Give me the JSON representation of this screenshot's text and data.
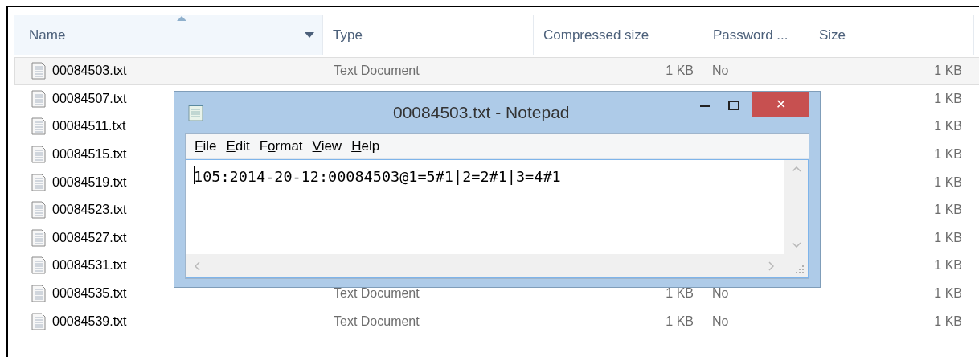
{
  "explorer": {
    "columns": [
      {
        "label": "Name",
        "sorted": true
      },
      {
        "label": "Type",
        "sorted": false
      },
      {
        "label": "Compressed size",
        "sorted": false
      },
      {
        "label": "Password ...",
        "sorted": false
      },
      {
        "label": "Size",
        "sorted": false
      }
    ],
    "rows": [
      {
        "name": "00084503.txt",
        "type": "Text Document",
        "compressed": "1 KB",
        "password": "No",
        "size": "1 KB",
        "selected": true
      },
      {
        "name": "00084507.txt",
        "size": "1 KB",
        "selected": false
      },
      {
        "name": "00084511.txt",
        "size": "1 KB",
        "selected": false
      },
      {
        "name": "00084515.txt",
        "size": "1 KB",
        "selected": false
      },
      {
        "name": "00084519.txt",
        "size": "1 KB",
        "selected": false
      },
      {
        "name": "00084523.txt",
        "size": "1 KB",
        "selected": false
      },
      {
        "name": "00084527.txt",
        "size": "1 KB",
        "selected": false
      },
      {
        "name": "00084531.txt",
        "size": "1 KB",
        "selected": false
      },
      {
        "name": "00084535.txt",
        "type": "Text Document",
        "compressed": "1 KB",
        "password": "No",
        "size": "1 KB",
        "selected": false
      },
      {
        "name": "00084539.txt",
        "type": "Text Document",
        "compressed": "1 KB",
        "password": "No",
        "size": "1 KB",
        "selected": false
      }
    ]
  },
  "notepad": {
    "title": "00084503.txt - Notepad",
    "close_glyph": "✕",
    "menu": [
      {
        "key": "F",
        "post": "ile"
      },
      {
        "key": "E",
        "post": "dit"
      },
      {
        "pre": "F",
        "key": "o",
        "post": "rmat"
      },
      {
        "key": "V",
        "post": "iew"
      },
      {
        "key": "H",
        "post": "elp"
      }
    ],
    "content": "105:2014-20-12:00084503@1=5#1|2=2#1|3=4#1"
  }
}
